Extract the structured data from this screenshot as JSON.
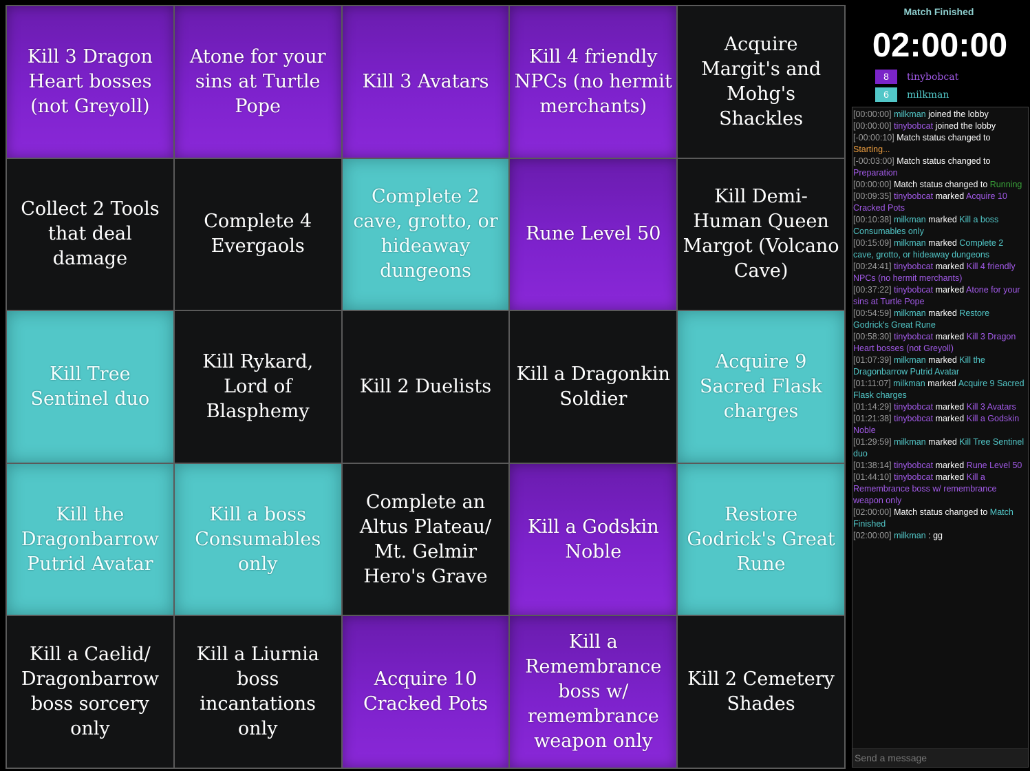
{
  "board": {
    "cells": [
      {
        "text": "Kill 3 Dragon Heart bosses (not Greyoll)",
        "owner": "purple"
      },
      {
        "text": "Atone for your sins at Turtle Pope",
        "owner": "purple"
      },
      {
        "text": "Kill 3 Avatars",
        "owner": "purple"
      },
      {
        "text": "Kill 4 friendly NPCs (no hermit merchants)",
        "owner": "purple"
      },
      {
        "text": "Acquire Margit's and Mohg's Shackles",
        "owner": "none"
      },
      {
        "text": "Collect 2 Tools that deal damage",
        "owner": "none"
      },
      {
        "text": "Complete 4 Evergaols",
        "owner": "none"
      },
      {
        "text": "Complete 2 cave, grotto, or hideaway dungeons",
        "owner": "teal"
      },
      {
        "text": "Rune Level 50",
        "owner": "purple"
      },
      {
        "text": "Kill Demi-Human Queen Margot (Volcano Cave)",
        "owner": "none"
      },
      {
        "text": "Kill Tree Sentinel duo",
        "owner": "teal"
      },
      {
        "text": "Kill Rykard, Lord of Blasphemy",
        "owner": "none"
      },
      {
        "text": "Kill 2 Duelists",
        "owner": "none"
      },
      {
        "text": "Kill a Dragonkin Soldier",
        "owner": "none"
      },
      {
        "text": "Acquire 9 Sacred Flask charges",
        "owner": "teal"
      },
      {
        "text": "Kill the Dragonbarrow Putrid Avatar",
        "owner": "teal"
      },
      {
        "text": "Kill a boss Consumables only",
        "owner": "teal"
      },
      {
        "text": "Complete an Altus Plateau/ Mt. Gelmir Hero's Grave",
        "owner": "none"
      },
      {
        "text": "Kill a Godskin Noble",
        "owner": "purple"
      },
      {
        "text": "Restore Godrick's Great Rune",
        "owner": "teal"
      },
      {
        "text": "Kill a Caelid/ Dragonbarrow boss sorcery only",
        "owner": "none"
      },
      {
        "text": "Kill a Liurnia boss incantations only",
        "owner": "none"
      },
      {
        "text": "Acquire 10 Cracked Pots",
        "owner": "purple"
      },
      {
        "text": "Kill a Remembrance boss w/ remembrance weapon only",
        "owner": "purple"
      },
      {
        "text": "Kill 2 Cemetery Shades",
        "owner": "none"
      }
    ]
  },
  "sidebar": {
    "status": "Match Finished",
    "timer": "02:00:00",
    "teams": [
      {
        "score": "8",
        "name": "tinybobcat"
      },
      {
        "score": "6",
        "name": "milkman"
      }
    ],
    "chat_placeholder": "Send a message"
  },
  "chat_log": [
    {
      "ts": "[00:00:00]",
      "user": "milkman",
      "text": "joined the lobby"
    },
    {
      "ts": "[00:00:00]",
      "user": "tinybobcat",
      "text": "joined the lobby"
    },
    {
      "ts": "[-00:00:10]",
      "text": "Match status changed to",
      "status": "Starting...",
      "status_color": "orange"
    },
    {
      "ts": "[-00:03:00]",
      "text": "Match status changed to",
      "status": "Preparation",
      "status_color": "purple"
    },
    {
      "ts": "[00:00:00]",
      "text": "Match status changed to",
      "status": "Running",
      "status_color": "green"
    },
    {
      "ts": "[00:09:35]",
      "user": "tinybobcat",
      "text": "marked",
      "target": "Acquire 10 Cracked Pots"
    },
    {
      "ts": "[00:10:38]",
      "user": "milkman",
      "text": "marked",
      "target": "Kill a boss Consumables only"
    },
    {
      "ts": "[00:15:09]",
      "user": "milkman",
      "text": "marked",
      "target": "Complete 2 cave, grotto, or hideaway dungeons"
    },
    {
      "ts": "[00:24:41]",
      "user": "tinybobcat",
      "text": "marked",
      "target": "Kill 4 friendly NPCs (no hermit merchants)"
    },
    {
      "ts": "[00:37:22]",
      "user": "tinybobcat",
      "text": "marked",
      "target": "Atone for your sins at Turtle Pope"
    },
    {
      "ts": "[00:54:59]",
      "user": "milkman",
      "text": "marked",
      "target": "Restore Godrick's Great Rune"
    },
    {
      "ts": "[00:58:30]",
      "user": "tinybobcat",
      "text": "marked",
      "target": "Kill 3 Dragon Heart bosses (not Greyoll)"
    },
    {
      "ts": "[01:07:39]",
      "user": "milkman",
      "text": "marked",
      "target": "Kill the Dragonbarrow Putrid Avatar"
    },
    {
      "ts": "[01:11:07]",
      "user": "milkman",
      "text": "marked",
      "target": "Acquire 9 Sacred Flask charges"
    },
    {
      "ts": "[01:14:29]",
      "user": "tinybobcat",
      "text": "marked",
      "target": "Kill 3 Avatars"
    },
    {
      "ts": "[01:21:38]",
      "user": "tinybobcat",
      "text": "marked",
      "target": "Kill a Godskin Noble"
    },
    {
      "ts": "[01:29:59]",
      "user": "milkman",
      "text": "marked",
      "target": "Kill Tree Sentinel duo"
    },
    {
      "ts": "[01:38:14]",
      "user": "tinybobcat",
      "text": "marked",
      "target": "Rune Level 50"
    },
    {
      "ts": "[01:44:10]",
      "user": "tinybobcat",
      "text": "marked",
      "target": "Kill a Remembrance boss w/ remembrance weapon only"
    },
    {
      "ts": "[02:00:00]",
      "text": "Match status changed to",
      "status": "Match Finished",
      "status_color": "teal"
    },
    {
      "ts": "[02:00:00]",
      "user": "milkman",
      "text": ": gg"
    }
  ]
}
